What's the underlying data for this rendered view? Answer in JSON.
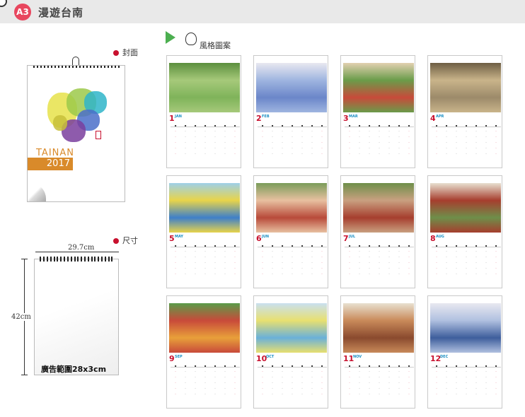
{
  "header": {
    "badge": "A3",
    "title": "漫遊台南"
  },
  "labels": {
    "cover": "封面",
    "size": "尺寸",
    "styles": "風格圖案"
  },
  "cover": {
    "title": "TAINAN",
    "year": "2017"
  },
  "size": {
    "width": "29.7cm",
    "height": "42cm",
    "ad_area": "廣告範圍28x3cm"
  },
  "months": [
    {
      "num": "1",
      "abbr": "JAN"
    },
    {
      "num": "2",
      "abbr": "FEB"
    },
    {
      "num": "3",
      "abbr": "MAR"
    },
    {
      "num": "4",
      "abbr": "APR"
    },
    {
      "num": "5",
      "abbr": "MAY"
    },
    {
      "num": "6",
      "abbr": "JUN"
    },
    {
      "num": "7",
      "abbr": "JUL"
    },
    {
      "num": "8",
      "abbr": "AUG"
    },
    {
      "num": "9",
      "abbr": "SEP"
    },
    {
      "num": "10",
      "abbr": "OCT"
    },
    {
      "num": "11",
      "abbr": "NOV"
    },
    {
      "num": "12",
      "abbr": "DEC"
    }
  ],
  "colors": {
    "accent": "#e8465e",
    "red": "#c8102e",
    "blue": "#1b8fc3",
    "orange": "#d98a2a"
  }
}
